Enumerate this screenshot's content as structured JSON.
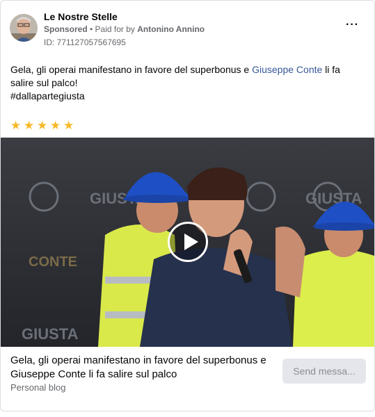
{
  "header": {
    "page_name": "Le Nostre Stelle",
    "sponsored_label": "Sponsored",
    "separator": " • ",
    "paid_for_prefix": "Paid for by ",
    "payer": "Antonino Annino",
    "ad_id": "ID: 771127057567695",
    "more_icon": "···"
  },
  "post": {
    "text_before_link": "Gela, gli operai manifestano in favore del superbonus e ",
    "link_text": "Giuseppe Conte",
    "text_after_link": " li fa salire sul palco!",
    "hashtag": "#dallapartegiusta",
    "rating_stars": 5,
    "star_glyph": "★"
  },
  "video": {
    "banner_texts": [
      "GIUSTA",
      "GIUSTA",
      "CONTE",
      "GIUSTA"
    ],
    "play_icon": "play-icon"
  },
  "footer": {
    "headline": "Gela, gli operai manifestano in favore del superbonus e Giuseppe Conte li fa salire sul palco",
    "subline": "Personal blog",
    "send_label": "Send messa..."
  },
  "colors": {
    "link": "#385898",
    "star": "#f7b928",
    "muted": "#65676b"
  }
}
